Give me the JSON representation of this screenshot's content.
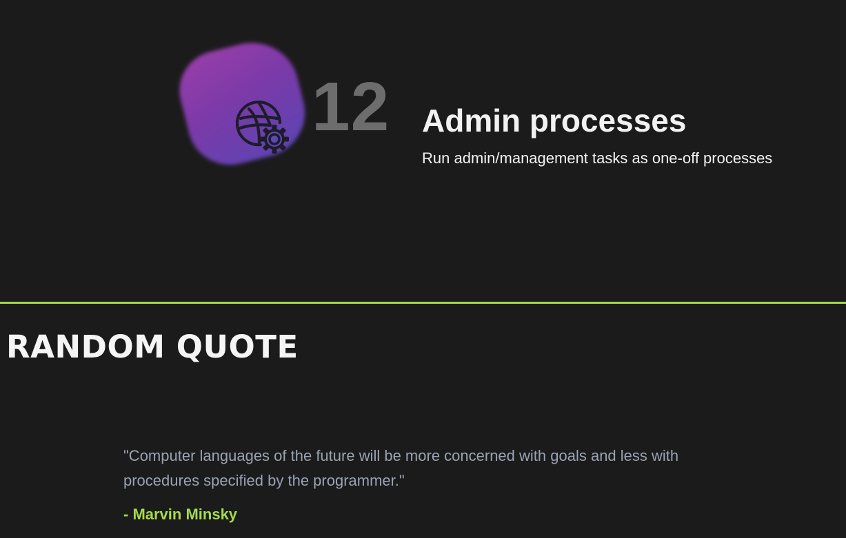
{
  "feature": {
    "number": "12",
    "title": "Admin processes",
    "description": "Run admin/management tasks as one-off processes",
    "icon": "globe-gear-icon"
  },
  "random_quote": {
    "heading": "RANDOM QUOTE",
    "text": "\"Computer languages of the future will be more concerned with goals and less with procedures specified by the programmer.\"",
    "author": "- Marvin Minsky"
  },
  "colors": {
    "background": "#1b1b1b",
    "accent": "#a5db4a",
    "number": "#6d6d6d",
    "quote_text": "#9aa3b4",
    "blob_top": "#9a3ea8",
    "blob_bottom": "#5a45b3"
  }
}
